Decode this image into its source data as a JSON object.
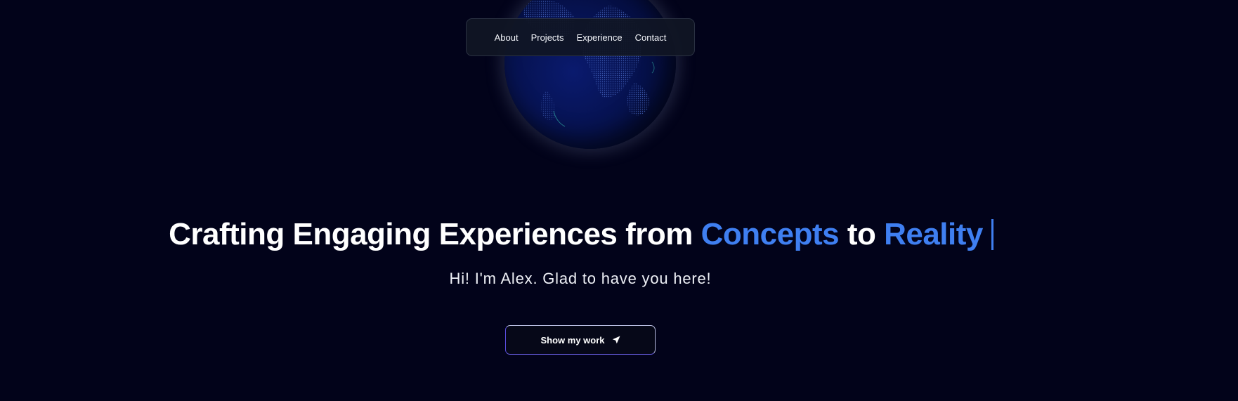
{
  "nav": {
    "items": [
      {
        "label": "About"
      },
      {
        "label": "Projects"
      },
      {
        "label": "Experience"
      },
      {
        "label": "Contact"
      }
    ]
  },
  "hero": {
    "headline_part1": "Crafting Engaging Experiences from ",
    "headline_accent1": "Concepts",
    "headline_part2": " to ",
    "headline_accent2": "Reality",
    "subtitle": "Hi! I'm Alex. Glad to have you here!",
    "cta_label": "Show my work",
    "cta_icon": "send-icon"
  },
  "colors": {
    "background": "#02031a",
    "accent": "#3f7ff1",
    "globe": "#06124f"
  }
}
